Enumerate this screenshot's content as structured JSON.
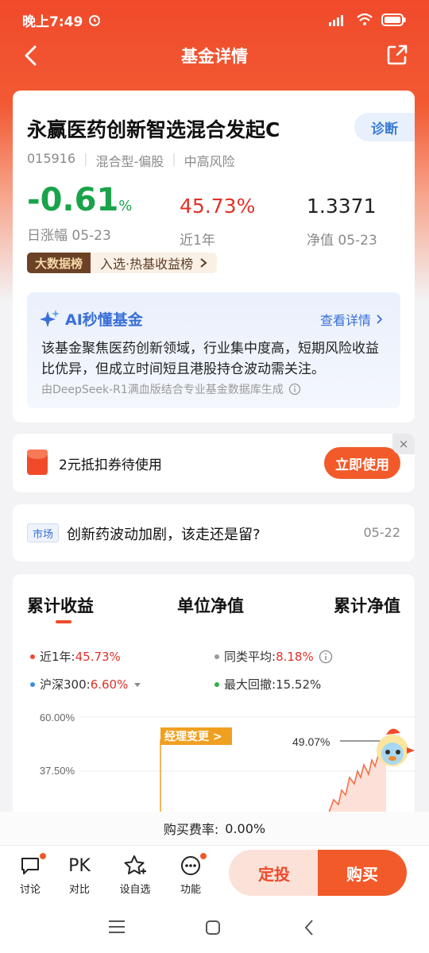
{
  "status": {
    "time": "晚上7:49"
  },
  "nav": {
    "title": "基金详情"
  },
  "fund": {
    "name": "永赢医药创新智选混合发起C",
    "diagnose": "诊断",
    "code": "015916",
    "type": "混合型-偏股",
    "risk": "中高风险",
    "daily_change": "-0.61",
    "daily_change_unit": "%",
    "daily_label": "日涨幅 05-23",
    "year_return": "45.73%",
    "year_label": "近1年",
    "nav_value": "1.3371",
    "nav_label": "净值 05-23",
    "bigdata_tag": "大数据榜",
    "bigdata_text": "入选·热基收益榜"
  },
  "ai": {
    "title": "AI秒懂基金",
    "link": "查看详情",
    "desc": "该基金聚焦医药创新领域，行业集中度高，短期风险收益比优异，但成立时间短且港股持仓波动需关注。",
    "footer": "由DeepSeek-R1满血版结合专业基金数据库生成"
  },
  "coupon": {
    "text": "2元抵扣券待使用",
    "button": "立即使用",
    "close": "×"
  },
  "news": {
    "tag": "市场",
    "title": "创新药波动加剧，该走还是留?",
    "date": "05-22"
  },
  "chart": {
    "tabs": [
      "累计收益",
      "单位净值",
      "累计净值"
    ],
    "legend": [
      {
        "label": "近1年:",
        "value": "45.73%",
        "color": "#f04a2b"
      },
      {
        "label": "同类平均:",
        "value": "8.18%",
        "color": "#999999"
      },
      {
        "label": "沪深300:",
        "value": "6.60%",
        "color": "#3a8ee6"
      },
      {
        "label": "最大回撤:",
        "value": "15.52%",
        "color": "#2bb24c"
      }
    ],
    "y_ticks": [
      "60.00%",
      "37.50%"
    ],
    "manager_change": "经理变更 >",
    "end_value": "49.07%"
  },
  "chart_data": {
    "type": "line",
    "series": [
      {
        "name": "近1年",
        "values": [
          45.73
        ]
      }
    ],
    "ylim": [
      37.5,
      60.0
    ]
  },
  "fee": {
    "label": "购买费率:",
    "value": "0.00%"
  },
  "bottom": {
    "items": [
      "讨论",
      "对比",
      "设自选",
      "功能"
    ],
    "pk": "PK",
    "dingtou": "定投",
    "buy": "购买"
  },
  "colors": {
    "accent": "#f04a2b",
    "up": "#e0312a",
    "down": "#1aa34a",
    "link": "#3a6fd6"
  }
}
